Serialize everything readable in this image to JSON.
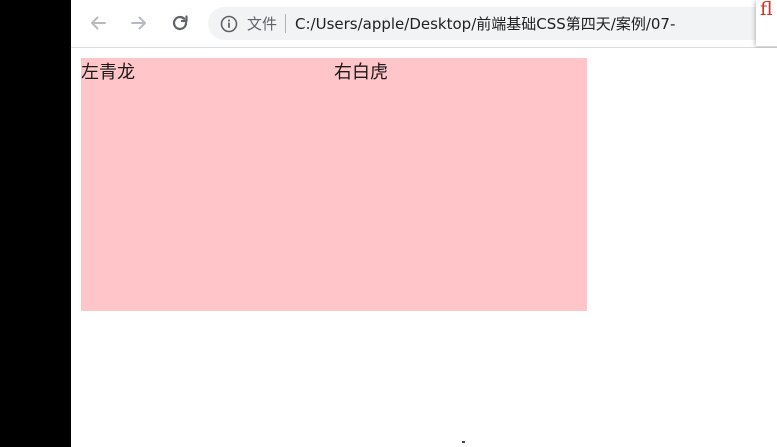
{
  "browser": {
    "toolbar": {
      "back_icon": "arrow-left-icon",
      "forward_icon": "arrow-right-icon",
      "reload_icon": "reload-icon"
    },
    "omnibox": {
      "info_icon": "info-icon",
      "security_label": "文件",
      "url": "C:/Users/apple/Desktop/前端基础CSS第四天/案例/07-"
    },
    "popup": {
      "text": "fl",
      "color": "#d93025"
    }
  },
  "page": {
    "box_color": "#ffc5c8",
    "left_text": "左青龙",
    "right_text": "右白虎"
  }
}
